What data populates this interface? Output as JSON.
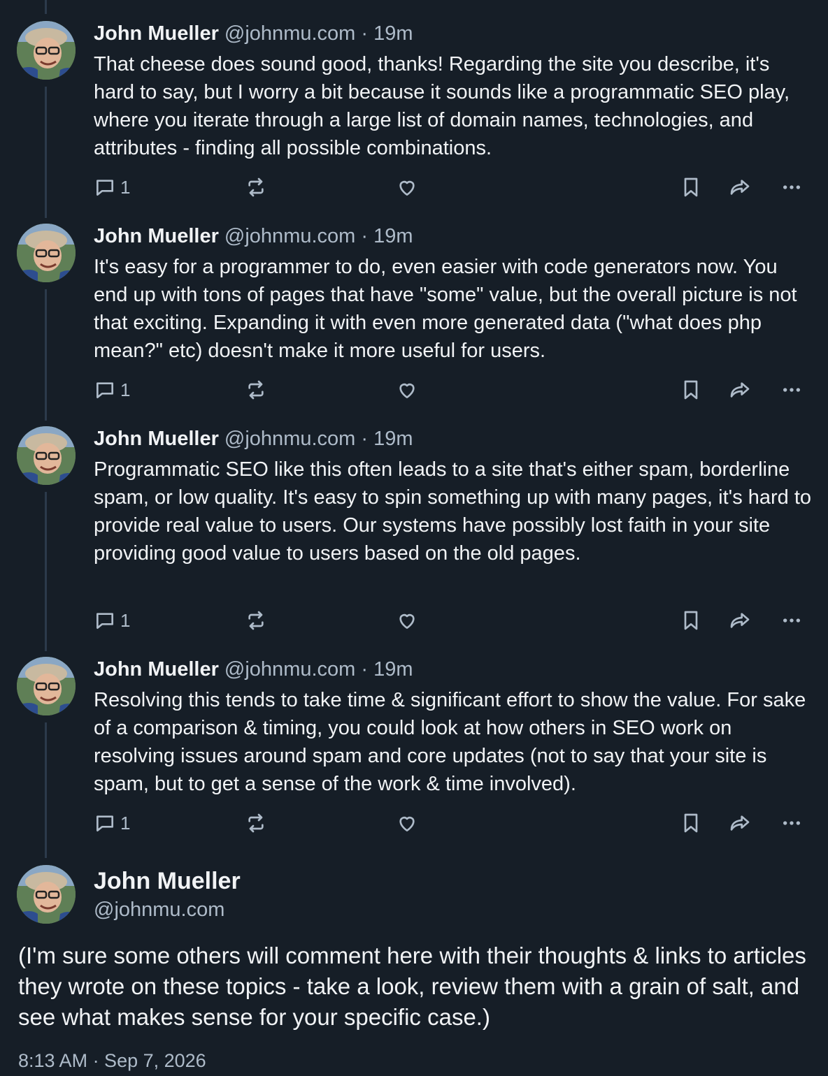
{
  "thread": [
    {
      "author": "John Mueller",
      "handle": "@johnmu.com",
      "separator": "·",
      "time": "19m",
      "text": "That cheese does sound good, thanks! Regarding the site you describe, it's hard to say, but I worry a bit because it sounds like a programmatic SEO play, where you iterate through a large list of domain names, technologies, and attributes - finding all possible combinations.",
      "reply_count": "1"
    },
    {
      "author": "John Mueller",
      "handle": "@johnmu.com",
      "separator": "·",
      "time": "19m",
      "text": "It's easy for a programmer to do, even easier with code generators now. You end up with tons of pages that have \"some\" value, but the overall picture is not that exciting. Expanding it with even more generated data (\"what does php mean?\" etc) doesn't make it more useful for users.",
      "reply_count": "1"
    },
    {
      "author": "John Mueller",
      "handle": "@johnmu.com",
      "separator": "·",
      "time": "19m",
      "text": "Programmatic SEO like this often leads to a site that's either spam, borderline spam, or low quality. It's easy to spin something up with many pages, it's hard to provide real value to users. Our systems have possibly lost faith in your site providing good value to users based on the old pages.",
      "reply_count": "1"
    },
    {
      "author": "John Mueller",
      "handle": "@johnmu.com",
      "separator": "·",
      "time": "19m",
      "text": "Resolving this tends to take time & significant effort to show the value. For sake of a comparison & timing, you could look at how others in SEO work on resolving issues around spam and core updates (not to say that your site is spam, but to get a sense of the work & time involved).",
      "reply_count": "1"
    }
  ],
  "main_post": {
    "author": "John Mueller",
    "handle": "@johnmu.com",
    "text": "(I'm sure some others will comment here with their thoughts & links to articles they wrote on these topics - take a look, review them with a grain of salt, and see what makes sense for your specific case.)",
    "timestamp": "8:13 AM · Sep 7, 2026"
  },
  "icons": {
    "reply": "speech-bubble-icon",
    "repost": "repost-arrows-icon",
    "like": "heart-icon",
    "bookmark": "bookmark-icon",
    "share": "share-arrow-icon",
    "more": "ellipsis-icon"
  },
  "colors": {
    "background": "#161e27",
    "text": "#f1f3f5",
    "muted": "#aebbc9",
    "thread_line": "#2c3a4b"
  }
}
